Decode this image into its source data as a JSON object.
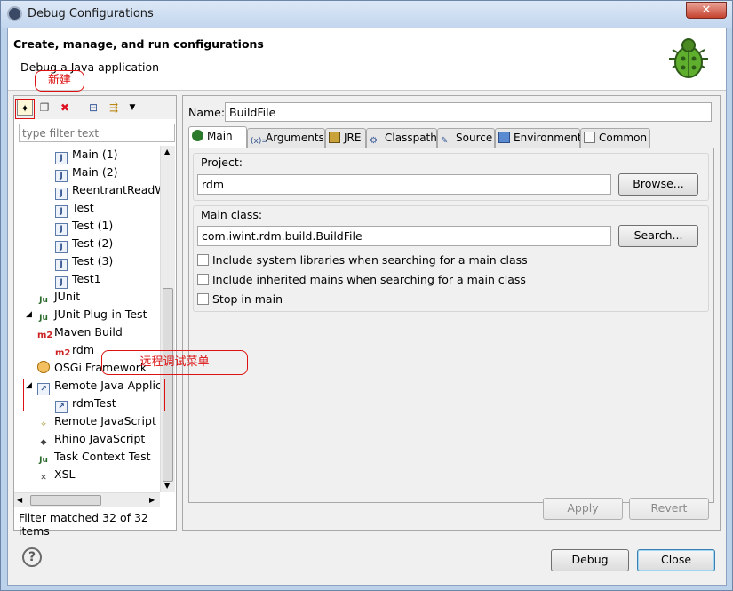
{
  "window": {
    "title": "Debug Configurations",
    "close": "✕"
  },
  "header": {
    "title": "Create, manage, and run configurations",
    "subtitle": "Debug a Java application"
  },
  "left": {
    "filter_placeholder": "type filter text",
    "status": "Filter matched 32 of 32 items",
    "tree": [
      {
        "label": "Main (1)",
        "icon": "J"
      },
      {
        "label": "Main (2)",
        "icon": "J"
      },
      {
        "label": "ReentrantReadW",
        "icon": "J"
      },
      {
        "label": "Test",
        "icon": "J"
      },
      {
        "label": "Test (1)",
        "icon": "J"
      },
      {
        "label": "Test (2)",
        "icon": "J"
      },
      {
        "label": "Test (3)",
        "icon": "J"
      },
      {
        "label": "Test1",
        "icon": "J"
      },
      {
        "label": "JUnit",
        "icon": "Ju"
      },
      {
        "label": "JUnit Plug-in Test",
        "icon": "Ju"
      },
      {
        "label": "Maven Build",
        "icon": "m2"
      },
      {
        "label": "rdm",
        "icon": "m2"
      },
      {
        "label": "OSGi Framework",
        "icon": "osgi"
      },
      {
        "label": "Remote Java Applic",
        "icon": "remote"
      },
      {
        "label": "rdmTest",
        "icon": "remote"
      },
      {
        "label": "Remote JavaScript",
        "icon": "js"
      },
      {
        "label": "Rhino JavaScript",
        "icon": "rhino"
      },
      {
        "label": "Task Context Test",
        "icon": "Ju"
      },
      {
        "label": "XSL",
        "icon": "xsl"
      }
    ]
  },
  "right": {
    "name_label": "Name:",
    "name_value": "BuildFile",
    "tabs": [
      {
        "label": "Main",
        "icon": "main-icon"
      },
      {
        "label": "Arguments",
        "icon": "arguments-icon"
      },
      {
        "label": "JRE",
        "icon": "jre-icon"
      },
      {
        "label": "Classpath",
        "icon": "classpath-icon"
      },
      {
        "label": "Source",
        "icon": "source-icon"
      },
      {
        "label": "Environment",
        "icon": "environment-icon"
      },
      {
        "label": "Common",
        "icon": "common-icon"
      }
    ],
    "project_label": "Project:",
    "project_value": "rdm",
    "browse": "Browse...",
    "mainclass_label": "Main class:",
    "mainclass_value": "com.iwint.rdm.build.BuildFile",
    "search": "Search...",
    "check1": "Include system libraries when searching for a main class",
    "check2": "Include inherited mains when searching for a main class",
    "check3": "Stop in main",
    "apply": "Apply",
    "revert": "Revert"
  },
  "footer": {
    "help": "?",
    "debug": "Debug",
    "close": "Close"
  },
  "annotations": {
    "new": "新建",
    "remote": "远程调试菜单"
  },
  "colors": {
    "annotation": "#dd1111",
    "titlebar": "#c3d6ee"
  }
}
